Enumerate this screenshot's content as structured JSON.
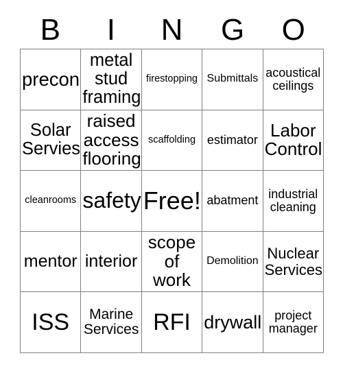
{
  "card": {
    "title": "BINGO",
    "header_letters": [
      "B",
      "I",
      "N",
      "G",
      "O"
    ],
    "free_space_label": "Free!",
    "grid_size": "5x5",
    "colors": {
      "background": "#ffffff",
      "text": "#000000",
      "border": "#808080"
    },
    "cells": [
      [
        {
          "label": "precon",
          "size": "fs-ml"
        },
        {
          "label": "metal stud framing",
          "size": "fs-md"
        },
        {
          "label": "firestopping",
          "size": "fs-tiny"
        },
        {
          "label": "Submittals",
          "size": "fs-xxs"
        },
        {
          "label": "acoustical ceilings",
          "size": "fs-xs"
        }
      ],
      [
        {
          "label": "Solar Servies",
          "size": "fs-md"
        },
        {
          "label": "raised access flooring",
          "size": "fs-md"
        },
        {
          "label": "scaffolding",
          "size": "fs-tiny"
        },
        {
          "label": "estimator",
          "size": "fs-xs"
        },
        {
          "label": "Labor Control",
          "size": "fs-md"
        }
      ],
      [
        {
          "label": "cleanrooms",
          "size": "fs-tiny"
        },
        {
          "label": "safety",
          "size": "fs-lg"
        },
        {
          "label": "Free!",
          "size": "fs-xxl"
        },
        {
          "label": "abatment",
          "size": "fs-xs"
        },
        {
          "label": "industrial cleaning",
          "size": "fs-xs"
        }
      ],
      [
        {
          "label": "mentor",
          "size": "fs-mdb"
        },
        {
          "label": "interior",
          "size": "fs-mdb"
        },
        {
          "label": "scope of work",
          "size": "fs-md"
        },
        {
          "label": "Demolition",
          "size": "fs-xxs"
        },
        {
          "label": "Nuclear Services",
          "size": "fs-sm"
        }
      ],
      [
        {
          "label": "ISS",
          "size": "fs-xl"
        },
        {
          "label": "Marine Services",
          "size": "fs-smb"
        },
        {
          "label": "RFI",
          "size": "fs-xl"
        },
        {
          "label": "drywall",
          "size": "fs-ml"
        },
        {
          "label": "project manager",
          "size": "fs-xs"
        }
      ]
    ]
  }
}
